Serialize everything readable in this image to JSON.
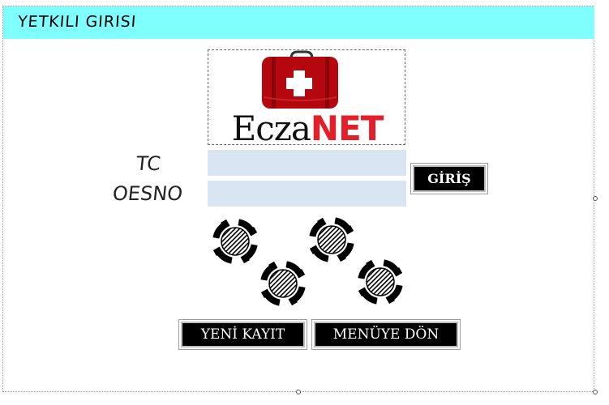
{
  "window": {
    "title": "YETKILI GIRISI",
    "header_color": "#80ffff"
  },
  "logo": {
    "text_part1": "Ecza",
    "text_part2": "NET",
    "brand_red": "#c40b12"
  },
  "form": {
    "tc_label": "TC",
    "oesno_label": "OESNO",
    "tc_value": "",
    "oesno_value": "",
    "field_color": "#d9e5f2"
  },
  "buttons": {
    "login": "GİRİŞ",
    "new_record": "YENİ KAYIT",
    "back_to_menu": "MENÜYE DÖN"
  },
  "decorations": [
    "loading-gear-icon",
    "loading-gear-icon",
    "loading-gear-icon",
    "loading-gear-icon"
  ]
}
